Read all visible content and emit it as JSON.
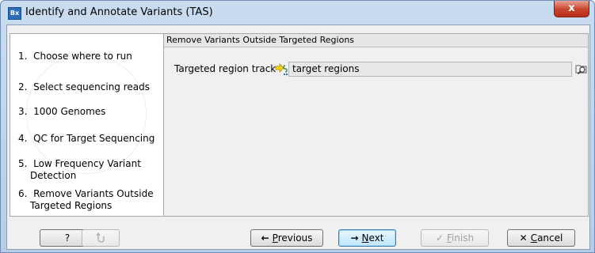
{
  "window": {
    "title": "Identify and Annotate Variants (TAS)",
    "app_icon_text": "Bx",
    "close_label": "x"
  },
  "steps": [
    {
      "number": "1.",
      "lines": [
        "Choose where to run"
      ]
    },
    {
      "number": "2.",
      "lines": [
        "Select sequencing reads"
      ]
    },
    {
      "number": "3.",
      "lines": [
        "1000 Genomes"
      ]
    },
    {
      "number": "4.",
      "lines": [
        "QC for Target Sequencing"
      ]
    },
    {
      "number": "5.",
      "lines": [
        "Low Frequency Variant",
        "Detection"
      ]
    },
    {
      "number": "6.",
      "lines": [
        "Remove Variants Outside",
        "Targeted Regions"
      ]
    }
  ],
  "panel": {
    "title": "Remove Variants Outside Targeted Regions",
    "region_label": "Targeted region track",
    "region_value": "target regions",
    "track_icon": "track-icon",
    "browse_icon": "browse-folder-icon"
  },
  "buttons": {
    "help": "?",
    "reset_icon": "reset-icon",
    "previous": {
      "arrow": "←",
      "mnemonic": "P",
      "rest": "revious"
    },
    "next": {
      "arrow": "→",
      "mnemonic": "N",
      "rest": "ext"
    },
    "finish": {
      "check": "✓",
      "mnemonic": "F",
      "rest": "inish"
    },
    "cancel": {
      "x": "✕",
      "mnemonic": "C",
      "rest": "ancel"
    }
  },
  "colors": {
    "accent": "#2c6cb8",
    "close": "#c7432b",
    "default_button": "#bee6fd"
  }
}
